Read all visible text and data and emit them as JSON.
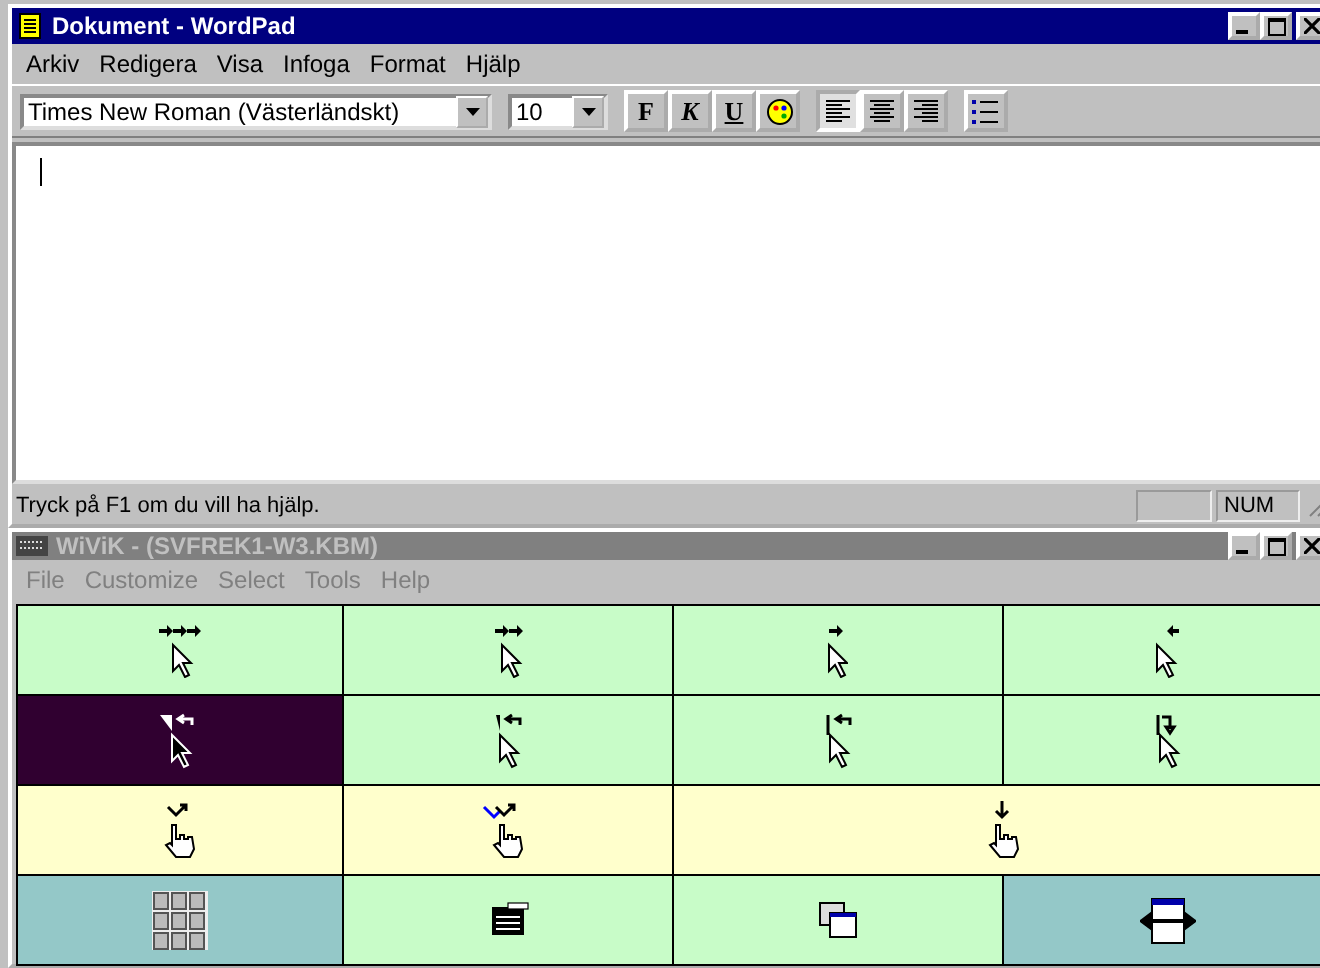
{
  "wordpad": {
    "title": "Dokument - WordPad",
    "active": true,
    "menu": [
      {
        "label": "Arkiv"
      },
      {
        "label": "Redigera"
      },
      {
        "label": "Visa"
      },
      {
        "label": "Infoga"
      },
      {
        "label": "Format"
      },
      {
        "label": "Hjälp"
      }
    ],
    "font": "Times New Roman (Västerländskt)",
    "size": "10",
    "format_buttons": [
      "F",
      "K",
      "U"
    ],
    "align": [
      {
        "kind": "left",
        "selected": true
      },
      {
        "kind": "center",
        "selected": false
      },
      {
        "kind": "right",
        "selected": false
      }
    ],
    "status": "Tryck på F1 om du vill ha hjälp.",
    "indicator": "NUM"
  },
  "wivik": {
    "title": "WiViK -  (SVFREK1-W3.KBM)",
    "active": false,
    "menu": [
      {
        "label": "File"
      },
      {
        "label": "Customize"
      },
      {
        "label": "Select"
      },
      {
        "label": "Tools"
      },
      {
        "label": "Help"
      }
    ],
    "rows": [
      [
        {
          "kind": "step3",
          "color": "#c8fcc8",
          "selected": false,
          "wide": false
        },
        {
          "kind": "step2",
          "color": "#c8fcc8",
          "selected": false,
          "wide": false
        },
        {
          "kind": "step1",
          "color": "#c8fcc8",
          "selected": false,
          "wide": false
        },
        {
          "kind": "back1",
          "color": "#c8fcc8",
          "selected": false,
          "wide": false
        }
      ],
      [
        {
          "kind": "dragstart",
          "color": "#300030",
          "selected": true,
          "wide": false
        },
        {
          "kind": "dragpick",
          "color": "#c8fcc8",
          "selected": false,
          "wide": false
        },
        {
          "kind": "dragline",
          "color": "#c8fcc8",
          "selected": false,
          "wide": false
        },
        {
          "kind": "dragdrop",
          "color": "#c8fcc8",
          "selected": false,
          "wide": false
        }
      ],
      [
        {
          "kind": "click",
          "color": "#ffffcc",
          "selected": false,
          "wide": false
        },
        {
          "kind": "doubleclick",
          "color": "#ffffcc",
          "selected": false,
          "wide": false
        },
        {
          "kind": "press",
          "color": "#ffffcc",
          "selected": false,
          "wide": true
        }
      ],
      [
        {
          "kind": "keyboard",
          "color": "#94c8c8",
          "selected": false,
          "wide": false
        },
        {
          "kind": "menu",
          "color": "#c8fcc8",
          "selected": false,
          "wide": false
        },
        {
          "kind": "windows",
          "color": "#c8fcc8",
          "selected": false,
          "wide": false
        },
        {
          "kind": "resize",
          "color": "#94c8c8",
          "selected": false,
          "wide": false
        }
      ]
    ]
  }
}
